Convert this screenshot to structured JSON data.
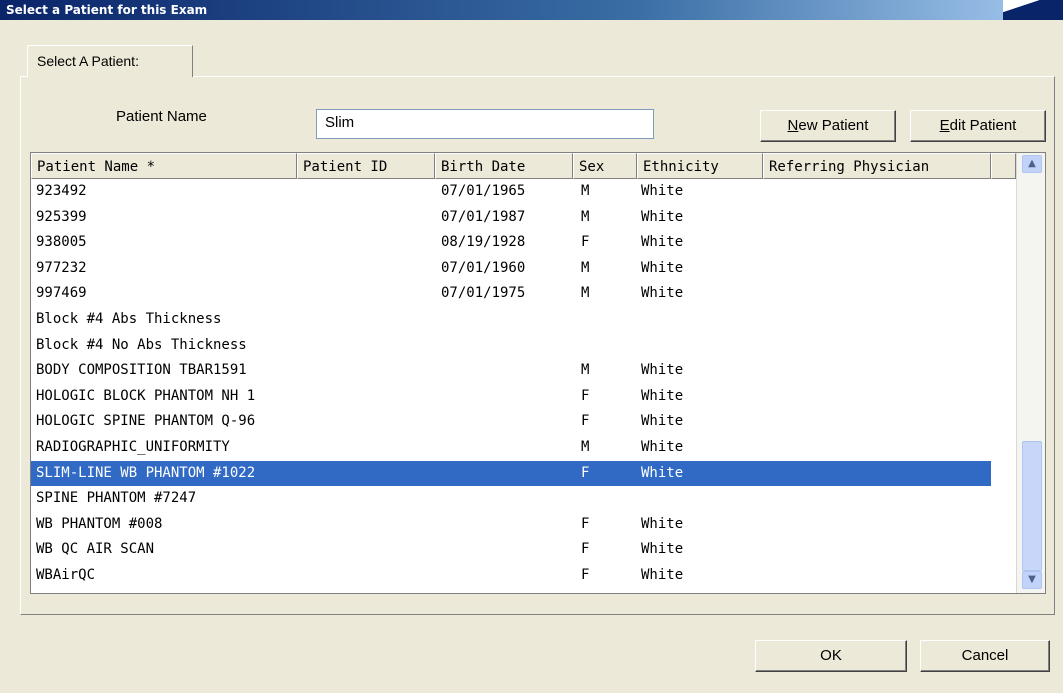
{
  "window": {
    "title": "Select a Patient for this Exam"
  },
  "tab": {
    "label": "Select A Patient:"
  },
  "search": {
    "label": "Patient Name",
    "value": "Slim"
  },
  "buttons": {
    "new_patient": {
      "mnemonic": "N",
      "rest": "ew Patient"
    },
    "edit_patient": {
      "mnemonic": "E",
      "rest": "dit Patient"
    },
    "ok": "OK",
    "cancel": "Cancel"
  },
  "table": {
    "columns": [
      "Patient Name *",
      "Patient ID",
      "Birth Date",
      "Sex",
      "Ethnicity",
      "Referring Physician"
    ],
    "selected_row": 11,
    "rows": [
      [
        "923492",
        "",
        "07/01/1965",
        "M",
        "White",
        ""
      ],
      [
        "925399",
        "",
        "07/01/1987",
        "M",
        "White",
        ""
      ],
      [
        "938005",
        "",
        "08/19/1928",
        "F",
        "White",
        ""
      ],
      [
        "977232",
        "",
        "07/01/1960",
        "M",
        "White",
        ""
      ],
      [
        "997469",
        "",
        "07/01/1975",
        "M",
        "White",
        ""
      ],
      [
        "Block #4 Abs Thickness",
        "",
        "",
        "",
        "",
        ""
      ],
      [
        "Block #4 No Abs Thickness",
        "",
        "",
        "",
        "",
        ""
      ],
      [
        "BODY COMPOSITION TBAR1591",
        "",
        "",
        "M",
        "White",
        ""
      ],
      [
        "HOLOGIC BLOCK PHANTOM NH 1",
        "",
        "",
        "F",
        "White",
        ""
      ],
      [
        "HOLOGIC SPINE PHANTOM Q-96",
        "",
        "",
        "F",
        "White",
        ""
      ],
      [
        "RADIOGRAPHIC_UNIFORMITY",
        "",
        "",
        "M",
        "White",
        ""
      ],
      [
        "SLIM-LINE WB PHANTOM #1022",
        "",
        "",
        "F",
        "White",
        ""
      ],
      [
        "SPINE PHANTOM #7247",
        "",
        "",
        "",
        "",
        ""
      ],
      [
        "WB PHANTOM #008",
        "",
        "",
        "F",
        "White",
        ""
      ],
      [
        "WB QC AIR SCAN",
        "",
        "",
        "F",
        "White",
        ""
      ],
      [
        "WBAirQC",
        "",
        "",
        "F",
        "White",
        ""
      ]
    ]
  },
  "colors": {
    "selection": "#316AC5",
    "window_bg": "#ECE9D8"
  },
  "icons": {
    "scroll_up": "chevron-up-icon",
    "scroll_down": "chevron-down-icon"
  }
}
